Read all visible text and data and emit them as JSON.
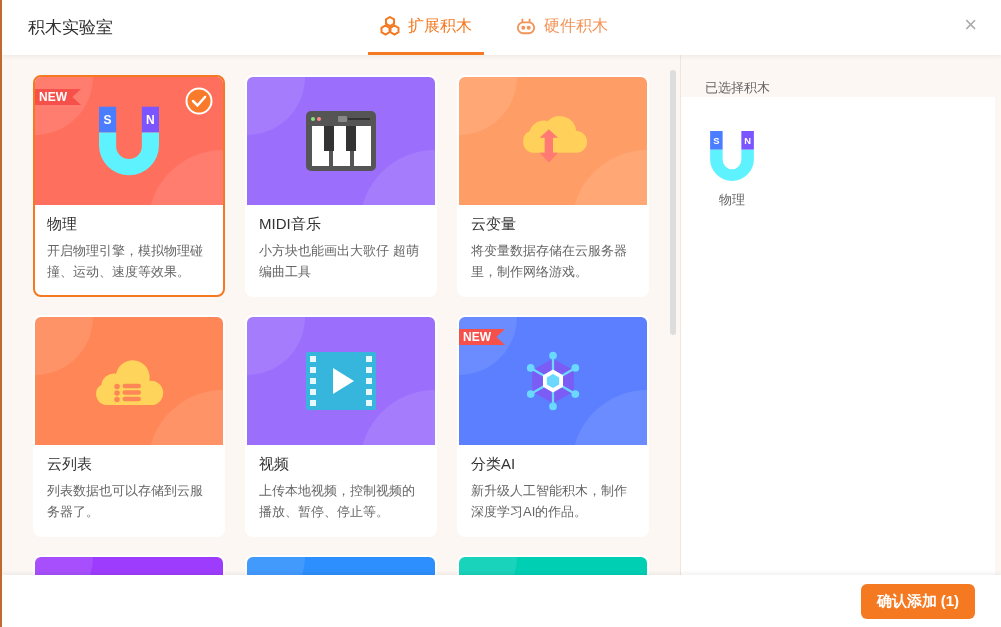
{
  "window": {
    "title": "积木实验室",
    "close": "×"
  },
  "tabs": [
    {
      "label": "扩展积木",
      "selected": true,
      "kind": "blocks"
    },
    {
      "label": "硬件积木",
      "selected": false,
      "kind": "robot"
    }
  ],
  "cards": [
    {
      "kind": "magnet",
      "color": "#ff6f5e",
      "title": "物理",
      "description": "开启物理引擎，模拟物理碰撞、运动、速度等效果。",
      "badge": "NEW",
      "selected": true,
      "icon_text": [
        "S",
        "N"
      ]
    },
    {
      "kind": "piano",
      "color": "#9b6ffc",
      "title": "MIDI音乐",
      "description": "小方块也能画出大歌仔 超萌编曲工具",
      "selected": false
    },
    {
      "kind": "cloud-arrow",
      "color": "#ff9d66",
      "title": "云变量",
      "description": "将变量数据存储在云服务器里，制作网络游戏。",
      "selected": false
    },
    {
      "kind": "cloud-list",
      "color": "#ff8757",
      "title": "云列表",
      "description": "列表数据也可以存储到云服务器了。",
      "selected": false
    },
    {
      "kind": "video",
      "color": "#9b6ffc",
      "title": "视频",
      "description": "上传本地视频，控制视频的播放、暂停、停止等。",
      "selected": false
    },
    {
      "kind": "network",
      "color": "#5b7ffe",
      "title": "分类AI",
      "description": "新升级人工智能积木，制作深度学习AI的作品。",
      "badge": "NEW",
      "selected": false
    },
    {
      "kind": "partial",
      "color": "#9e3cfd",
      "selected": false
    },
    {
      "kind": "partial",
      "color": "#2d8ffd",
      "selected": false
    },
    {
      "kind": "partial",
      "color": "#00cfb4",
      "selected": false
    }
  ],
  "selected_panel": {
    "heading": "已选择积木",
    "items": [
      {
        "kind": "magnet",
        "icon_text": [
          "S",
          "N"
        ],
        "label": "物理"
      }
    ]
  },
  "confirm_button": "确认添加 (1)"
}
